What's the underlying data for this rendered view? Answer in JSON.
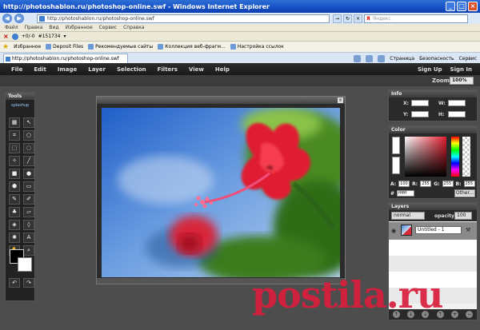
{
  "window": {
    "title": "http://photoshablon.ru/photoshop-online.swf - Windows Internet Explorer"
  },
  "addressbar": {
    "url": "http://photoshablon.ru/photoshop-online.swf",
    "search_placeholder": "Яндекс"
  },
  "ie_menu": [
    "Файл",
    "Правка",
    "Вид",
    "Избранное",
    "Сервис",
    "Справка"
  ],
  "toolbar2": {
    "counter": "+0/-0",
    "id": "#151734"
  },
  "favorites": {
    "label": "Избранное",
    "items": [
      "Deposit Files",
      "Рекомендуемые сайты",
      "Коллекция веб-фрагм...",
      "Настройка ссылок"
    ]
  },
  "tab": {
    "label": "http://photoshablon.ru/photoshop-online.swf"
  },
  "commandbar": [
    "Страница",
    "Безопасность",
    "Сервис"
  ],
  "app": {
    "menu": [
      "File",
      "Edit",
      "Image",
      "Layer",
      "Selection",
      "Filters",
      "View",
      "Help"
    ],
    "signup": "Sign Up",
    "signin": "Sign In",
    "zoom_label": "Zoom:",
    "zoom_value": "100%",
    "tools_title": "Tools",
    "logo_text": "splashup",
    "info_title": "Info",
    "info_labels": [
      "X:",
      "W:",
      "Y:",
      "H:"
    ],
    "color_title": "Color",
    "color_fields": {
      "A": "100",
      "R": "255",
      "G": "255",
      "B": "255",
      "hex": "ffffff"
    },
    "other_btn": "Other...",
    "layers_title": "Layers",
    "blend_mode": "normal",
    "opacity_label": "opacity:",
    "opacity_value": "100",
    "layer_name": "Untitled - 1"
  },
  "watermark": "postila.ru",
  "colors": {
    "accent_red": "#e21d2e",
    "ie_blue": "#1550c4",
    "app_bg": "#4d4d4d"
  }
}
